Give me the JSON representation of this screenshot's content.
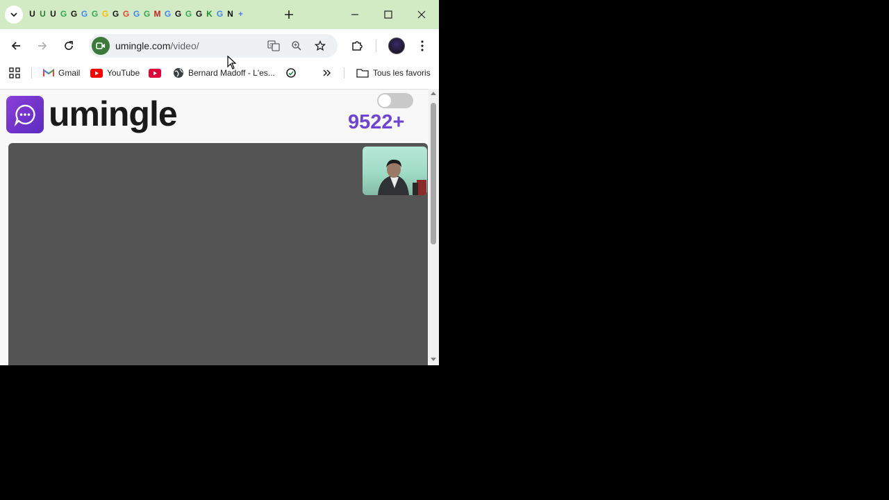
{
  "browser": {
    "favicons": [
      "U",
      "U",
      "U",
      "G",
      "G",
      "G",
      "G",
      "G",
      "G",
      "G",
      "G",
      "G",
      "M",
      "G",
      "G",
      "G",
      "G",
      "K",
      "G",
      "N",
      "+"
    ],
    "address": {
      "domain": "umingle.com",
      "path": "/video/"
    },
    "bookmarks": [
      {
        "label": "Gmail",
        "icon": "gmail-icon"
      },
      {
        "label": "YouTube",
        "icon": "youtube-icon"
      },
      {
        "label": "",
        "icon": "youtube-icon"
      },
      {
        "label": "Bernard Madoff - L'es...",
        "icon": "globe-icon"
      },
      {
        "label": "",
        "icon": "search-icon"
      }
    ],
    "all_bookmarks_label": "Tous les favoris"
  },
  "page": {
    "brand": "umingle",
    "online_count": "9522+",
    "toggle_on": false
  },
  "colors": {
    "tabbar": "#d3ebc5",
    "accent": "#6d44d3",
    "video_bg": "#545454"
  }
}
